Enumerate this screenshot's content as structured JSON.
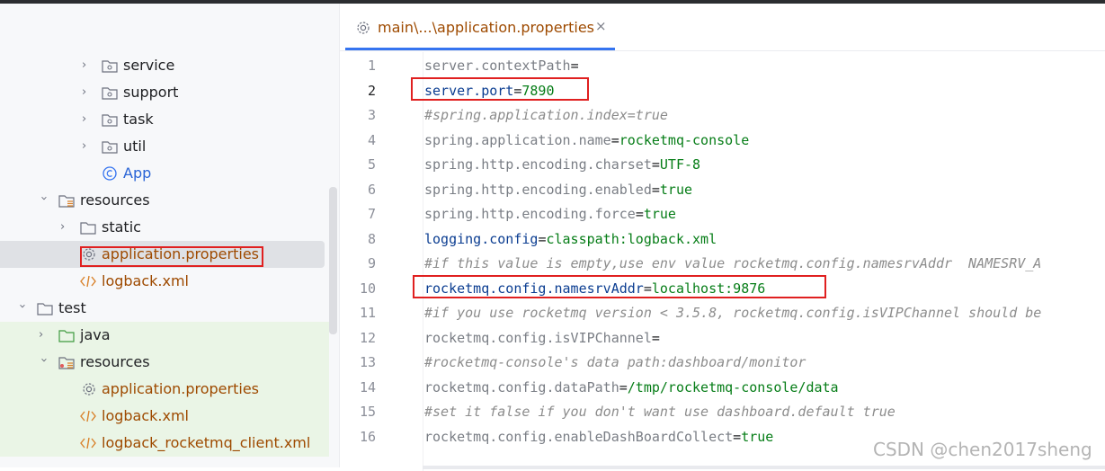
{
  "tree": {
    "rows": [
      {
        "label": "service",
        "kind": "package"
      },
      {
        "label": "support",
        "kind": "package"
      },
      {
        "label": "task",
        "kind": "package"
      },
      {
        "label": "util",
        "kind": "package"
      },
      {
        "label": "App",
        "kind": "class"
      },
      {
        "label": "resources",
        "kind": "resources"
      },
      {
        "label": "static",
        "kind": "folder"
      },
      {
        "label": "application.properties",
        "kind": "properties",
        "selected": true
      },
      {
        "label": "logback.xml",
        "kind": "xml"
      },
      {
        "label": "test",
        "kind": "folder"
      },
      {
        "label": "java",
        "kind": "test-source"
      },
      {
        "label": "resources",
        "kind": "test-resources"
      },
      {
        "label": "application.properties",
        "kind": "properties"
      },
      {
        "label": "logback.xml",
        "kind": "xml"
      },
      {
        "label": "logback_rocketmq_client.xml",
        "kind": "xml"
      }
    ]
  },
  "editor": {
    "tab_title": "main\\...\\application.properties",
    "close_glyph": "×",
    "current_line": 2,
    "lines": [
      {
        "n": "1",
        "key": "server.contextPath",
        "value": ""
      },
      {
        "n": "2",
        "key": "server.port",
        "value": "7890"
      },
      {
        "n": "3",
        "comment": "#spring.application.index=true"
      },
      {
        "n": "4",
        "key": "spring.application.name",
        "value": "rocketmq-console"
      },
      {
        "n": "5",
        "key": "spring.http.encoding.charset",
        "value": "UTF-8"
      },
      {
        "n": "6",
        "key": "spring.http.encoding.enabled",
        "value": "true"
      },
      {
        "n": "7",
        "key": "spring.http.encoding.force",
        "value": "true"
      },
      {
        "n": "8",
        "key": "logging.config",
        "value": "classpath:logback.xml"
      },
      {
        "n": "9",
        "comment": "#if this value is empty,use env value rocketmq.config.namesrvAddr  NAMESRV_A"
      },
      {
        "n": "10",
        "key": "rocketmq.config.namesrvAddr",
        "value": "localhost:9876"
      },
      {
        "n": "11",
        "comment": "#if you use rocketmq version < 3.5.8, rocketmq.config.isVIPChannel should be"
      },
      {
        "n": "12",
        "key": "rocketmq.config.isVIPChannel",
        "value": ""
      },
      {
        "n": "13",
        "comment": "#rocketmq-console's data path:dashboard/monitor"
      },
      {
        "n": "14",
        "key": "rocketmq.config.dataPath",
        "value": "/tmp/rocketmq-console/data"
      },
      {
        "n": "15",
        "comment": "#set it false if you don't want use dashboard.default true"
      },
      {
        "n": "16",
        "key": "rocketmq.config.enableDashBoardCollect",
        "value": "true"
      }
    ]
  },
  "watermark": "CSDN @chen2017sheng",
  "colors": {
    "highlight_box": "#e02020",
    "key": "#7a7e85",
    "value": "#067d17",
    "comment": "#8c8c8c",
    "file_orange": "#9e4a00"
  }
}
